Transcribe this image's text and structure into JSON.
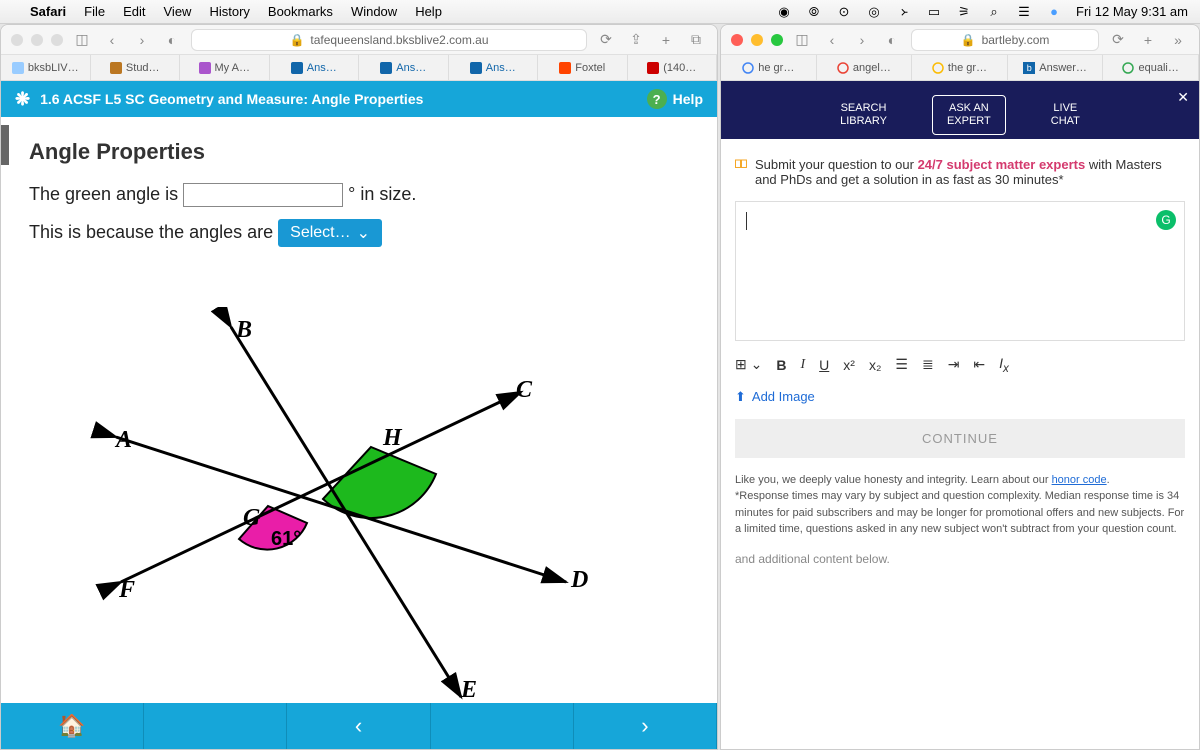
{
  "menubar": {
    "app": "Safari",
    "items": [
      "File",
      "Edit",
      "View",
      "History",
      "Bookmarks",
      "Window",
      "Help"
    ],
    "clock": "Fri 12 May  9:31 am"
  },
  "left_window": {
    "url": "tafequeensland.bksblive2.com.au",
    "tabs": [
      "bksbLIV…",
      "Stud…",
      "My A…",
      "Ans…",
      "Ans…",
      "Ans…",
      "Foxtel",
      "(140…"
    ],
    "lesson_title": "1.6 ACSF L5 SC Geometry and Measure: Angle Properties",
    "help": "Help",
    "heading": "Angle Properties",
    "line1_pre": "The green angle is ",
    "line1_post": " ° in size.",
    "line2_pre": "This is because the angles are ",
    "select_label": "Select…",
    "diagram": {
      "labels": {
        "A": "A",
        "B": "B",
        "C": "C",
        "D": "D",
        "E": "E",
        "F": "F",
        "G": "G",
        "H": "H"
      },
      "angle_value": "61°"
    }
  },
  "right_window": {
    "url": "bartleby.com",
    "tabs": [
      "he gr…",
      "angel…",
      "the gr…",
      "Answer…",
      "equali…"
    ],
    "pills": {
      "search": "SEARCH\nLIBRARY",
      "ask": "ASK AN\nEXPERT",
      "chat": "LIVE\nCHAT"
    },
    "submit_text_pre": "Submit your question to our ",
    "submit_text_bold": "24/7 subject matter experts",
    "submit_text_post": " with Masters and PhDs and get a solution in as fast as 30 minutes*",
    "add_image": "Add Image",
    "continue": "CONTINUE",
    "legal": "Like you, we deeply value honesty and integrity. Learn about our honor code.\n*Response times may vary by subject and question complexity. Median response time is 34 minutes for paid subscribers and may be longer for promotional offers and new subjects. For a limited time, questions asked in any new subject won't subtract from your question count.",
    "honor": "honor code",
    "additional": "and additional content below."
  }
}
